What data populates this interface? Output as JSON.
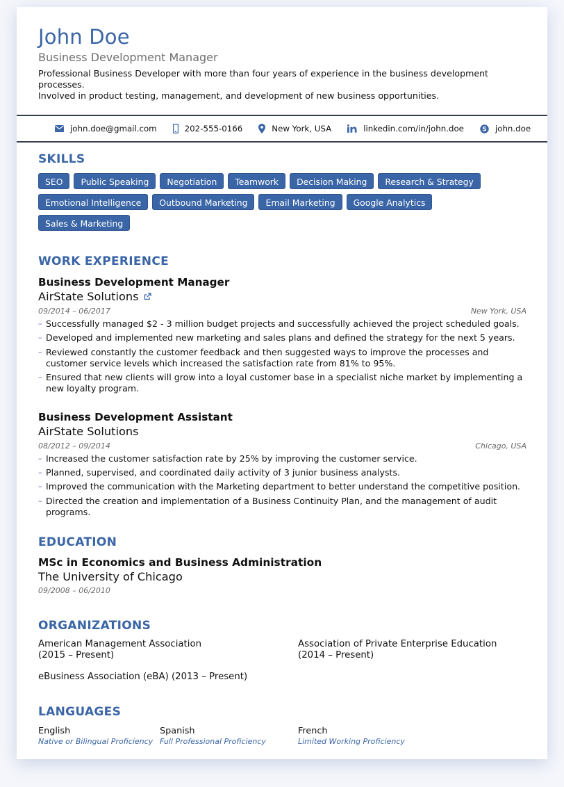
{
  "header": {
    "name": "John Doe",
    "title": "Business Development Manager",
    "summary_line1": "Professional Business Developer with more than four years of experience in the business development processes.",
    "summary_line2": "Involved in product testing, management, and development of new business opportunities."
  },
  "contact": {
    "email": "john.doe@gmail.com",
    "phone": "202-555-0166",
    "location": "New York, USA",
    "linkedin": "linkedin.com/in/john.doe",
    "skype": "john.doe"
  },
  "skills": {
    "heading": "SKILLS",
    "items": [
      "SEO",
      "Public Speaking",
      "Negotiation",
      "Teamwork",
      "Decision Making",
      "Research & Strategy",
      "Emotional Intelligence",
      "Outbound Marketing",
      "Email Marketing",
      "Google Analytics",
      "Sales & Marketing"
    ]
  },
  "work": {
    "heading": "WORK EXPERIENCE",
    "jobs": [
      {
        "title": "Business Development Manager",
        "company": "AirState Solutions",
        "dates": "09/2014 – 06/2017",
        "location": "New York, USA",
        "bullets": [
          "Successfully managed $2 - 3 million budget projects and successfully achieved the project scheduled goals.",
          "Developed and implemented new marketing and sales plans and defined the strategy for the next 5 years.",
          "Reviewed constantly the customer feedback and then suggested ways to improve the processes and customer service levels which increased the satisfaction rate from 81% to 95%.",
          "Ensured that new clients will grow into a loyal customer base in a specialist niche market by implementing a new loyalty program."
        ]
      },
      {
        "title": "Business Development Assistant",
        "company": "AirState Solutions",
        "dates": "08/2012 – 09/2014",
        "location": "Chicago, USA",
        "bullets": [
          "Increased the customer satisfaction rate by 25% by improving the customer service.",
          "Planned, supervised, and coordinated daily activity of 3 junior business analysts.",
          "Improved the communication with the Marketing department to better understand the competitive position.",
          "Directed the creation and implementation of a Business Continuity Plan, and the management of audit programs."
        ]
      }
    ]
  },
  "education": {
    "heading": "EDUCATION",
    "degree": "MSc in Economics and Business Administration",
    "school": "The University of Chicago",
    "dates": "09/2008 – 06/2010"
  },
  "organizations": {
    "heading": "ORGANIZATIONS",
    "items": [
      {
        "name": "American Management Association",
        "period": "(2015 – Present)"
      },
      {
        "name": "Association of Private Enterprise Education",
        "period": "(2014 – Present)"
      },
      {
        "name": "eBusiness Association (eBA) (2013 – Present)",
        "period": ""
      }
    ]
  },
  "languages": {
    "heading": "LANGUAGES",
    "items": [
      {
        "name": "English",
        "level": "Native or Bilingual Proficiency"
      },
      {
        "name": "Spanish",
        "level": "Full Professional Proficiency"
      },
      {
        "name": "French",
        "level": "Limited Working Proficiency"
      }
    ]
  },
  "colors": {
    "accent": "#3a65a6",
    "rule": "#34404f"
  }
}
